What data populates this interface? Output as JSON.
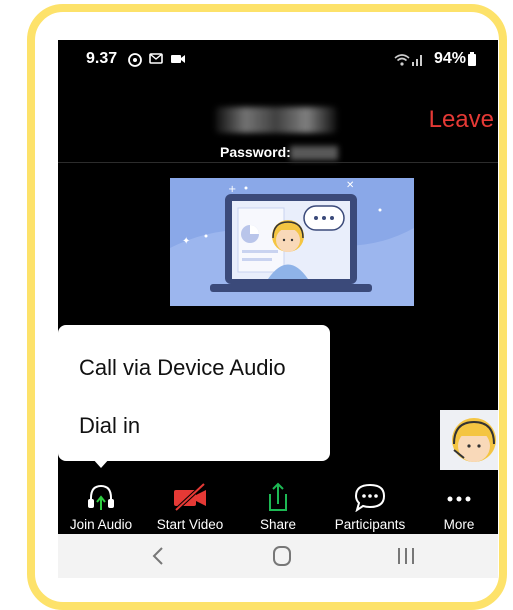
{
  "status_bar": {
    "time": "9.37",
    "battery_percent": "94%",
    "icons": [
      "whatsapp-icon",
      "message-icon",
      "video-camera-icon",
      "wifi-icon",
      "signal-icon",
      "battery-icon"
    ]
  },
  "meeting": {
    "leave_label": "Leave",
    "meeting_id": "395 554 5883",
    "password_label": "Password:",
    "password_value": "452849"
  },
  "audio_menu": {
    "items": [
      {
        "label": "Call via Device Audio"
      },
      {
        "label": "Dial in"
      }
    ]
  },
  "toolbar": {
    "items": [
      {
        "label": "Join Audio",
        "icon": "headphones-icon"
      },
      {
        "label": "Start Video",
        "icon": "video-off-icon"
      },
      {
        "label": "Share",
        "icon": "share-icon"
      },
      {
        "label": "Participants",
        "icon": "participants-icon"
      },
      {
        "label": "More",
        "icon": "more-icon"
      }
    ]
  },
  "nav_bar": {
    "items": [
      "back-icon",
      "home-icon",
      "recents-icon"
    ]
  },
  "colors": {
    "leave": "#e53935",
    "video_off": "#e53935",
    "share": "#1db954",
    "frame": "#fde26a",
    "illustration_bg": "#8aa8e8"
  }
}
